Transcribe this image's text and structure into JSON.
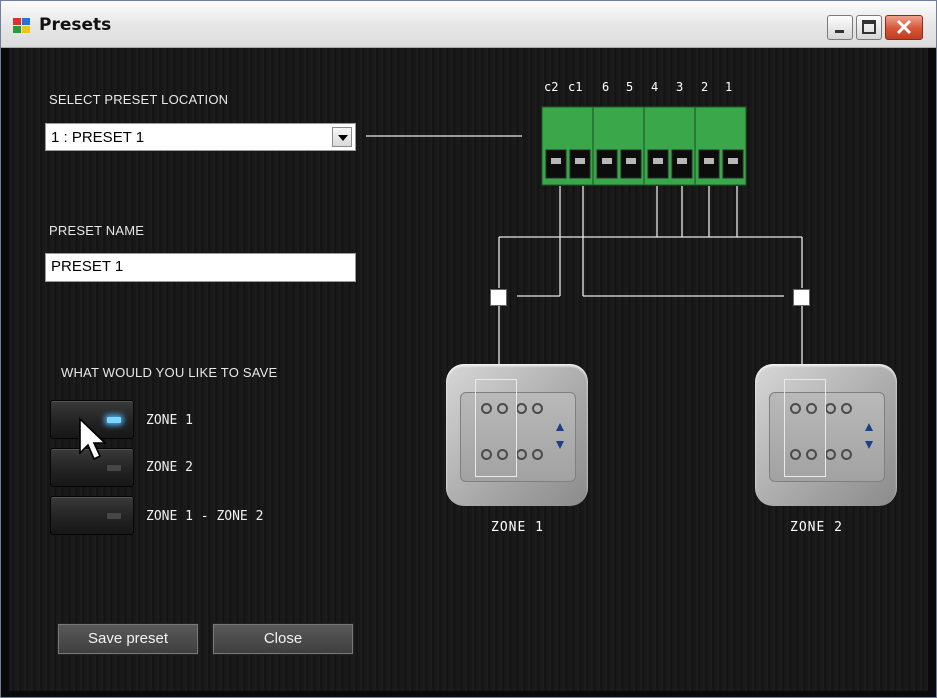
{
  "window": {
    "title": "Presets",
    "accent": "#d65536"
  },
  "form": {
    "location_label": "SELECT PRESET LOCATION",
    "location_value": "1 : PRESET 1",
    "name_label": "PRESET NAME",
    "name_value": "PRESET 1",
    "save_question": "WHAT WOULD YOU LIKE TO SAVE"
  },
  "options": [
    {
      "label": "ZONE 1",
      "active": true
    },
    {
      "label": "ZONE 2",
      "active": false
    },
    {
      "label": "ZONE 1 - ZONE 2",
      "active": false
    }
  ],
  "buttons": {
    "save": "Save preset",
    "close": "Close"
  },
  "terminals": [
    "c2",
    "c1",
    "6",
    "5",
    "4",
    "3",
    "2",
    "1"
  ],
  "zones": {
    "zone1": "ZONE 1",
    "zone2": "ZONE 2"
  },
  "icons": {
    "app": "presets-app-icon",
    "minimize": "minimize-icon",
    "maximize": "maximize-icon",
    "close": "close-x-icon",
    "cursor": "mouse-pointer-icon"
  }
}
